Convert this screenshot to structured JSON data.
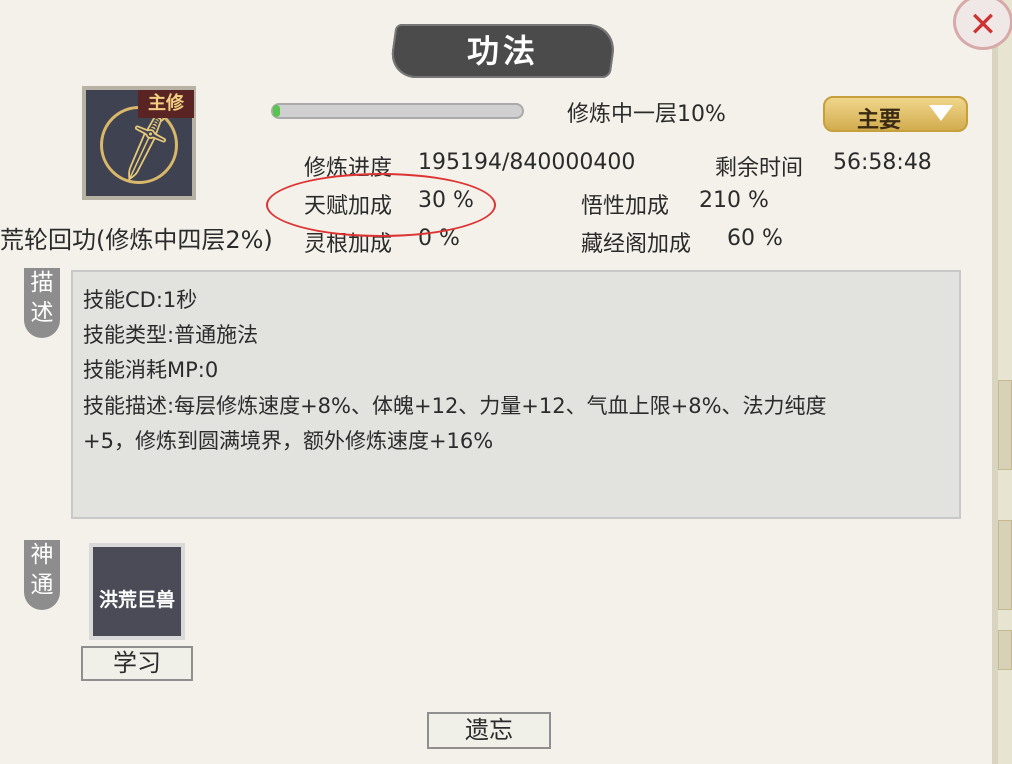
{
  "title": "功法",
  "close_icon": "close-icon",
  "skill": {
    "badge": "主修",
    "name": "荒轮回功(修炼中四层2%)",
    "progress": {
      "value": 0.03,
      "label": "修炼中一层10%"
    },
    "priority": {
      "label": "主要",
      "chevron": "triangle-down"
    }
  },
  "stats": {
    "cultivation_progress_label": "修炼进度",
    "cultivation_progress_value": "195194/840000400",
    "remaining_time_label": "剩余时间",
    "remaining_time_value": "56:58:48",
    "talent_bonus_label": "天赋加成",
    "talent_bonus_value": "30 %",
    "comprehension_bonus_label": "悟性加成",
    "comprehension_bonus_value": "210 %",
    "spirit_root_bonus_label": "灵根加成",
    "spirit_root_bonus_value": "0 %",
    "library_bonus_label": "藏经阁加成",
    "library_bonus_value": "60 %"
  },
  "sections": {
    "description_tag": [
      "描",
      "述"
    ],
    "divine_tag": [
      "神",
      "通"
    ]
  },
  "description": [
    "技能CD:1秒",
    "技能类型:普通施法",
    "技能消耗MP:0",
    "技能描述:每层修炼速度+8%、体魄+12、力量+12、气血上限+8%、法力纯度",
    "+5，修炼到圆满境界，额外修炼速度+16%"
  ],
  "divine": {
    "card_label": "洪荒巨兽",
    "learn_button": "学习"
  },
  "forget_button": "遗忘"
}
